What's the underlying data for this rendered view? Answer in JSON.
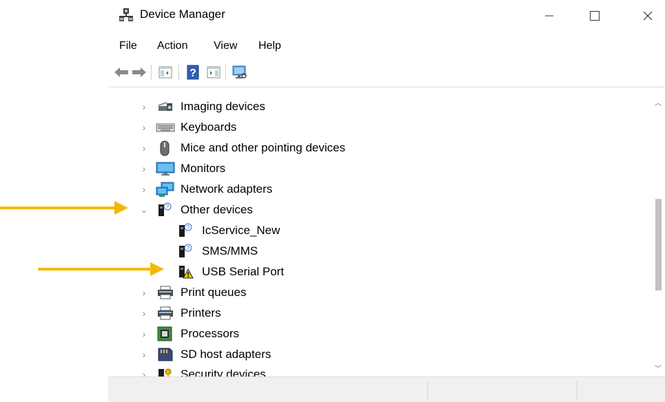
{
  "window": {
    "title": "Device Manager"
  },
  "menu": {
    "items": [
      "File",
      "Action",
      "View",
      "Help"
    ]
  },
  "tree": {
    "items": [
      {
        "label": "Imaging devices",
        "icon": "camera-icon",
        "level": 0,
        "expanded": false
      },
      {
        "label": "Keyboards",
        "icon": "keyboard-icon",
        "level": 0,
        "expanded": false
      },
      {
        "label": "Mice and other pointing devices",
        "icon": "mouse-icon",
        "level": 0,
        "expanded": false
      },
      {
        "label": "Monitors",
        "icon": "monitor-icon",
        "level": 0,
        "expanded": false
      },
      {
        "label": "Network adapters",
        "icon": "network-icon",
        "level": 0,
        "expanded": false
      },
      {
        "label": "Other devices",
        "icon": "unknown-device-icon",
        "level": 0,
        "expanded": true
      },
      {
        "label": "IcService_New",
        "icon": "unknown-device-icon",
        "level": 1
      },
      {
        "label": "SMS/MMS",
        "icon": "unknown-device-icon",
        "level": 1
      },
      {
        "label": "USB Serial Port",
        "icon": "warning-device-icon",
        "level": 1
      },
      {
        "label": "Print queues",
        "icon": "printer-icon",
        "level": 0,
        "expanded": false
      },
      {
        "label": "Printers",
        "icon": "printer-icon",
        "level": 0,
        "expanded": false
      },
      {
        "label": "Processors",
        "icon": "processor-icon",
        "level": 0,
        "expanded": false
      },
      {
        "label": "SD host adapters",
        "icon": "sd-card-icon",
        "level": 0,
        "expanded": false
      },
      {
        "label": "Security devices",
        "icon": "security-key-icon",
        "level": 0,
        "expanded": false
      }
    ]
  },
  "colors": {
    "arrow": "#f5b800",
    "accent": "#1e73c8",
    "warning": "#f3c200"
  }
}
